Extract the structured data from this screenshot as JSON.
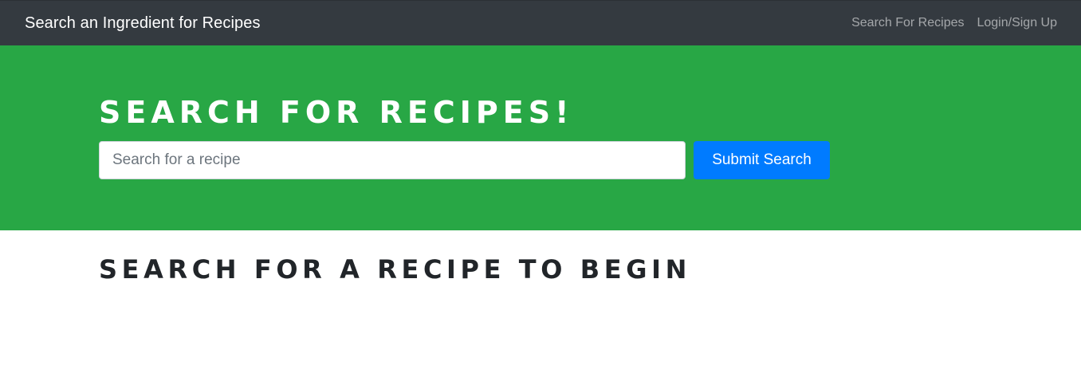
{
  "navbar": {
    "brand": "Search an Ingredient for Recipes",
    "links": [
      {
        "label": "Search For Recipes"
      },
      {
        "label": "Login/Sign Up"
      }
    ]
  },
  "hero": {
    "title": "Search For Recipes!",
    "search": {
      "placeholder": "Search for a recipe",
      "value": ""
    },
    "submit_label": "Submit Search"
  },
  "results": {
    "heading": "Search for a recipe to begin"
  },
  "colors": {
    "navbar_bg": "#343a40",
    "hero_bg": "#28a745",
    "button_bg": "#007bff",
    "heading_text": "#212529"
  }
}
